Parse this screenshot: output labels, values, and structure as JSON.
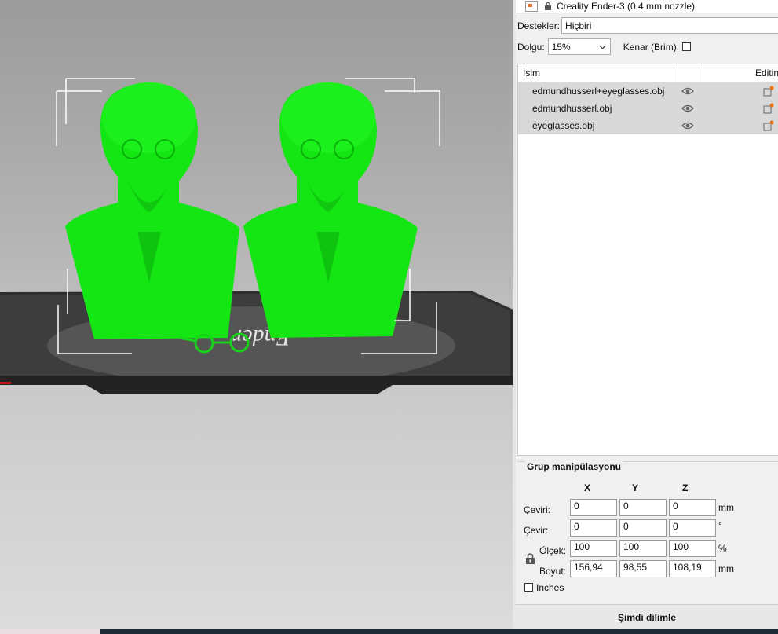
{
  "printer": {
    "name": "Creality Ender-3 (0.4 mm nozzle)"
  },
  "supports": {
    "label": "Destekler:",
    "value": "Hiçbiri"
  },
  "infill": {
    "label": "Dolgu:",
    "value": "15%"
  },
  "brim": {
    "label": "Kenar (Brim):",
    "checked": false
  },
  "object_list": {
    "col_name": "İsim",
    "col_editing": "Editin",
    "items": [
      {
        "name": "edmundhusserl+eyeglasses.obj"
      },
      {
        "name": "edmundhusserl.obj"
      },
      {
        "name": "eyeglasses.obj"
      }
    ]
  },
  "group_manipulation": {
    "title": "Grup manipülasyonu",
    "axes": [
      "X",
      "Y",
      "Z"
    ],
    "rows": [
      {
        "label": "Çeviri:",
        "values": [
          "0",
          "0",
          "0"
        ],
        "unit": "mm"
      },
      {
        "label": "Çevir:",
        "values": [
          "0",
          "0",
          "0"
        ],
        "unit": "°"
      },
      {
        "label": "Ölçek:",
        "values": [
          "100",
          "100",
          "100"
        ],
        "unit": "%"
      },
      {
        "label": "Boyut:",
        "values": [
          "156,94",
          "98,55",
          "108,19"
        ],
        "unit": "mm"
      }
    ],
    "inches_label": "Inches"
  },
  "slice_button": "Şimdi dilimle",
  "colors": {
    "model": "#14e614",
    "bed": "#3a3a3a",
    "panel_bg": "#f0f0f0",
    "selected_row": "#d9d9d9"
  }
}
